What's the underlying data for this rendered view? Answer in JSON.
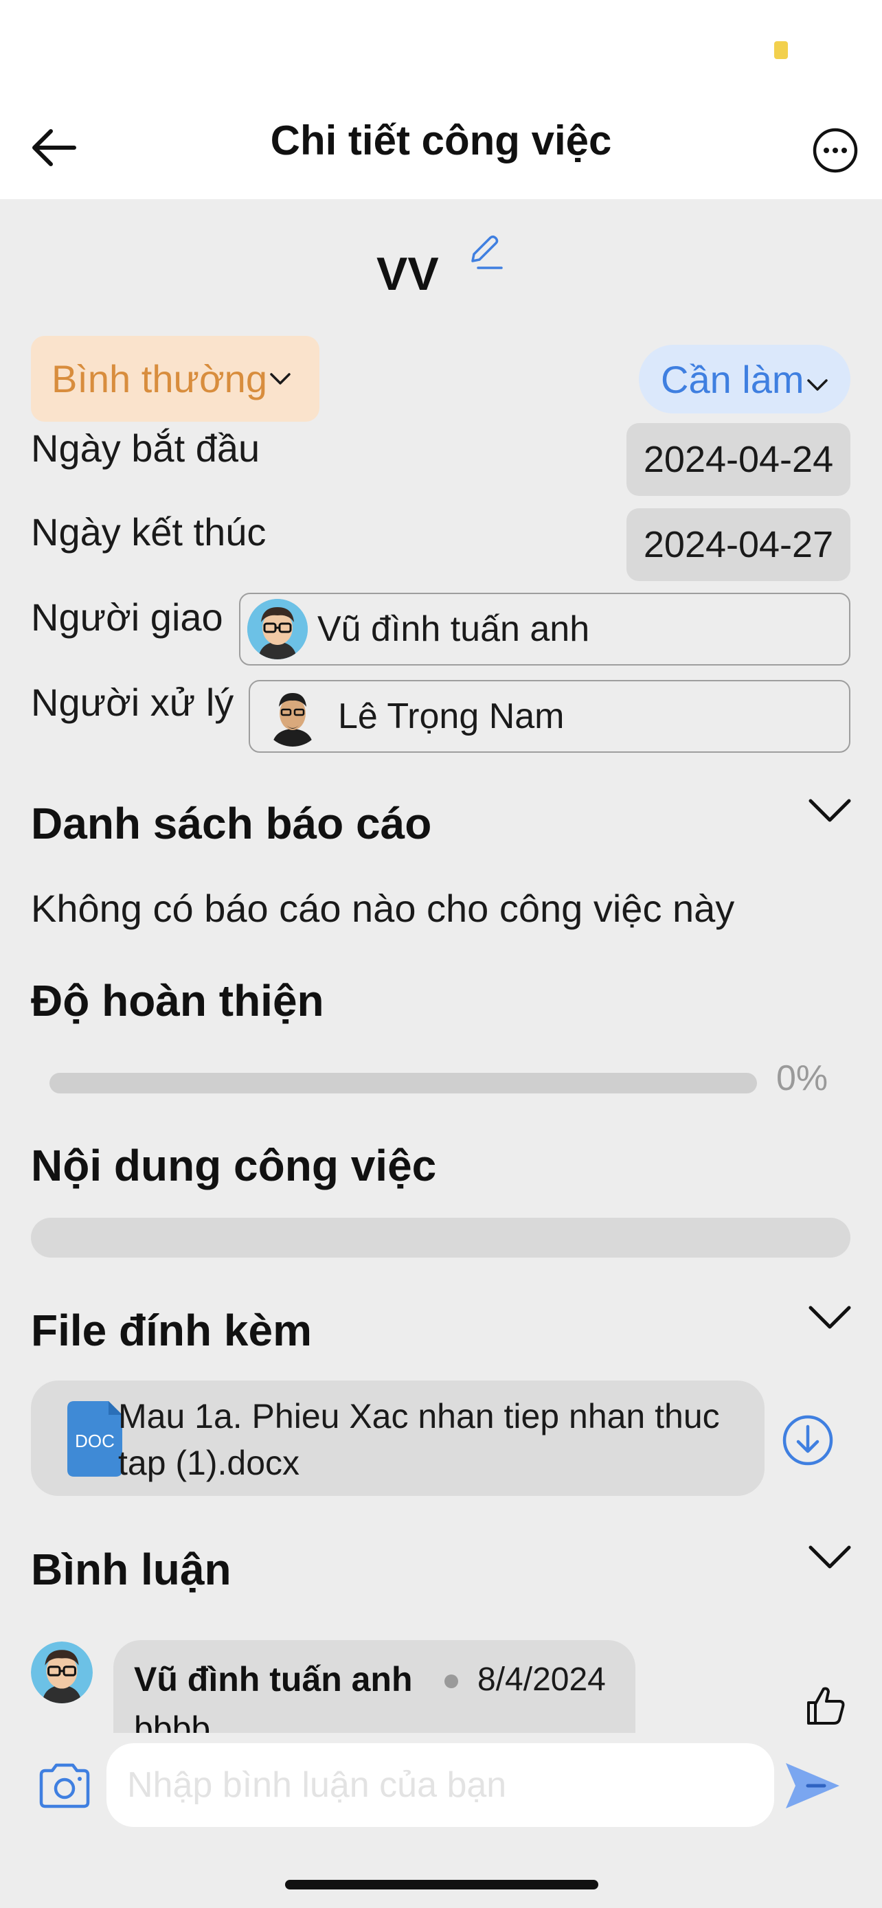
{
  "header": {
    "title": "Chi tiết công việc"
  },
  "task": {
    "name": "VV",
    "priority": "Bình thường",
    "status": "Cần làm",
    "start_label": "Ngày bắt đầu",
    "start_date": "2024-04-24",
    "end_label": "Ngày kết thúc",
    "end_date": "2024-04-27",
    "assigner_label": "Người giao",
    "assigner_name": "Vũ đình tuấn anh",
    "handler_label": "Người xử lý",
    "handler_name": "Lê Trọng Nam"
  },
  "reports": {
    "title": "Danh sách báo cáo",
    "empty_text": "Không có báo cáo nào cho công việc này"
  },
  "completion": {
    "title": "Độ hoàn thiện",
    "percent_label": "0%",
    "progress_fraction": 0
  },
  "content": {
    "title": "Nội dung công việc"
  },
  "attachments": {
    "title": "File đính kèm",
    "files": [
      {
        "name": "Mau 1a. Phieu Xac nhan tiep nhan thuc tap (1).docx",
        "icon_text": "DOC",
        "icon": "doc-file-icon"
      }
    ]
  },
  "comments": {
    "title": "Bình luận",
    "items": [
      {
        "author": "Vũ đình tuấn anh",
        "date": "8/4/2024",
        "text": "bbbb"
      }
    ],
    "input_placeholder": "Nhập bình luận của bạn"
  },
  "colors": {
    "accent": "#3f7fe0",
    "priority_text": "#d88d3d",
    "priority_bg": "#fae3cc",
    "status_bg": "#dbe8fb",
    "background": "#ededed"
  }
}
